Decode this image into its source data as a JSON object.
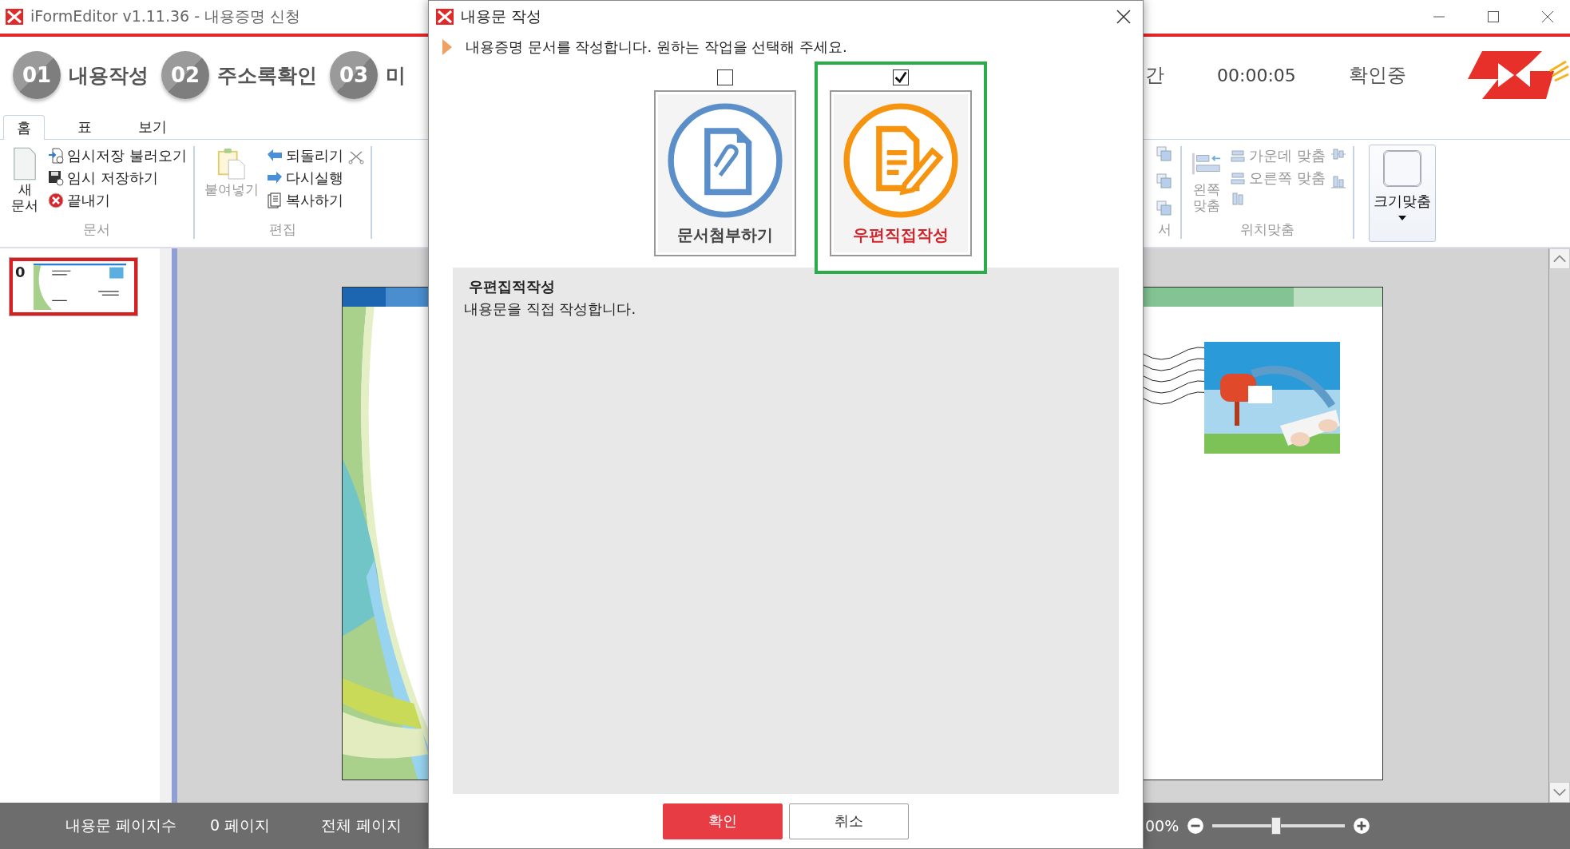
{
  "window": {
    "title": "iFormEditor v1.11.36 - 내용증명 신청"
  },
  "steps": [
    {
      "number": "01",
      "label": "내용작성"
    },
    {
      "number": "02",
      "label": "주소록확인"
    },
    {
      "number": "03",
      "label": "미"
    }
  ],
  "header_right": {
    "partial_label": "간",
    "timer": "00:00:05",
    "status": "확인중"
  },
  "ribbon_tabs": [
    {
      "label": "홈",
      "selected": true
    },
    {
      "label": "표",
      "selected": false
    },
    {
      "label": "보기",
      "selected": false
    }
  ],
  "ribbon_left": {
    "groups": [
      {
        "label": "문서",
        "big": {
          "label": "새 문서",
          "disabled": false
        },
        "items": [
          {
            "label": "임시저장 불러오기",
            "disabled": false
          },
          {
            "label": "임시 저장하기",
            "disabled": false
          },
          {
            "label": "끝내기",
            "disabled": false
          }
        ]
      },
      {
        "label": "편집",
        "big": {
          "label": "붙여넣기",
          "disabled": true
        },
        "items": [
          {
            "label": "되돌리기",
            "disabled": false
          },
          {
            "label": "다시실행",
            "disabled": false
          },
          {
            "label": "복사하기",
            "disabled": false
          }
        ]
      }
    ]
  },
  "ribbon_right": {
    "partial_group_label": "서",
    "align_group": {
      "label": "위치맞춤",
      "big": {
        "label": "왼쪽 맞춤",
        "disabled": true
      },
      "items": [
        {
          "label": "가운데 맞춤",
          "disabled": true
        },
        {
          "label": "오른쪽 맞춤",
          "disabled": true
        }
      ]
    },
    "fit_button": {
      "label": "크기맞춤"
    }
  },
  "thumbnails": [
    {
      "number": "0",
      "selected": true
    }
  ],
  "dialog": {
    "title": "내용문 작성",
    "instruction": "내용증명 문서를 작성합니다. 원하는 작업을 선택해 주세요.",
    "options": [
      {
        "label": "문서첨부하기",
        "checked": false,
        "selected": false
      },
      {
        "label": "우편직접작성",
        "checked": true,
        "selected": true
      }
    ],
    "description": {
      "title": "우편집적작성",
      "text": "내용문을 직접 작성합니다."
    },
    "buttons": [
      {
        "label": "확인",
        "kind": "primary"
      },
      {
        "label": "취소",
        "kind": "secondary"
      }
    ]
  },
  "status_bar": {
    "page_count_label": "내용문 페이지수",
    "page_count": "0 페이지",
    "total_label": "전체 페이지",
    "zoom": "00%",
    "zoom_level": {
      "level": 0.48
    }
  }
}
